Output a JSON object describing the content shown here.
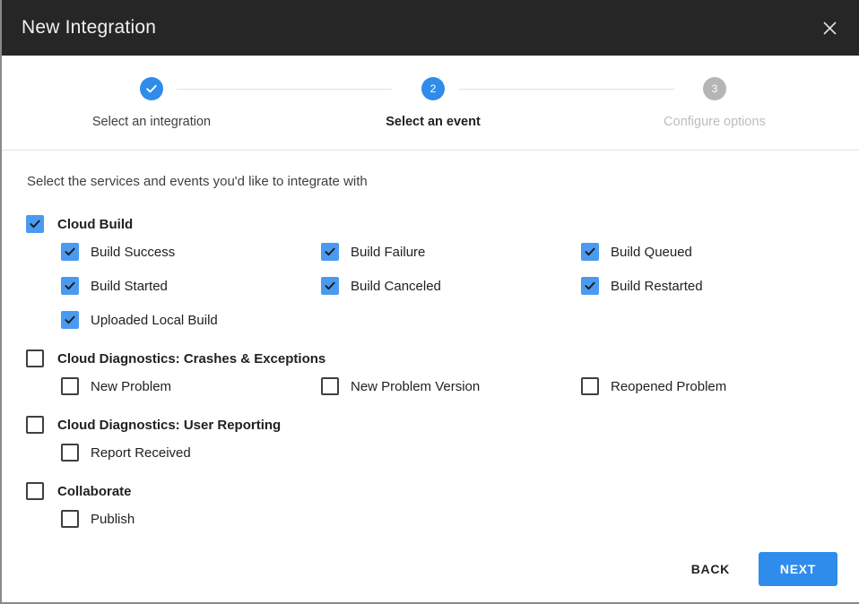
{
  "dialog": {
    "title": "New Integration",
    "close_icon": "close-icon"
  },
  "stepper": {
    "steps": [
      {
        "number": "1",
        "marker": "✓",
        "label": "Select an integration",
        "state": "done"
      },
      {
        "number": "2",
        "marker": "2",
        "label": "Select an event",
        "state": "active"
      },
      {
        "number": "3",
        "marker": "3",
        "label": "Configure options",
        "state": "pending"
      }
    ]
  },
  "content": {
    "intro": "Select the services and events you'd like to integrate with",
    "groups": [
      {
        "label": "Cloud Build",
        "checked": true,
        "events": [
          {
            "label": "Build Success",
            "checked": true
          },
          {
            "label": "Build Failure",
            "checked": true
          },
          {
            "label": "Build Queued",
            "checked": true
          },
          {
            "label": "Build Started",
            "checked": true
          },
          {
            "label": "Build Canceled",
            "checked": true
          },
          {
            "label": "Build Restarted",
            "checked": true
          },
          {
            "label": "Uploaded Local Build",
            "checked": true
          }
        ]
      },
      {
        "label": "Cloud Diagnostics: Crashes & Exceptions",
        "checked": false,
        "events": [
          {
            "label": "New Problem",
            "checked": false
          },
          {
            "label": "New Problem Version",
            "checked": false
          },
          {
            "label": "Reopened Problem",
            "checked": false
          }
        ]
      },
      {
        "label": "Cloud Diagnostics: User Reporting",
        "checked": false,
        "events": [
          {
            "label": "Report Received",
            "checked": false
          }
        ]
      },
      {
        "label": "Collaborate",
        "checked": false,
        "events": [
          {
            "label": "Publish",
            "checked": false
          }
        ]
      }
    ]
  },
  "footer": {
    "back_label": "BACK",
    "next_label": "NEXT"
  },
  "colors": {
    "accent": "#2f8ceb",
    "checkbox_on": "#4a9bf0",
    "titlebar": "#262626",
    "pending": "#b5b5b5"
  }
}
